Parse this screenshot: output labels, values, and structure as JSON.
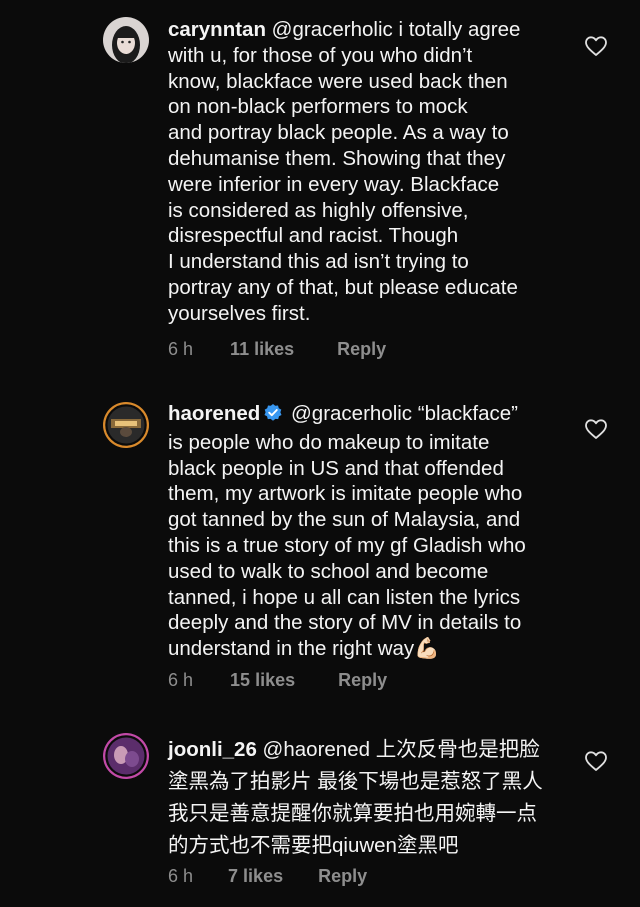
{
  "comments": [
    {
      "username": "carynntan",
      "verified": false,
      "text": " @gracerholic i totally agree\nwith u, for those of you who didn’t\nknow, blackface were used back then\non non-black performers to mock\nand portray black people. As a way to\ndehumanise them. Showing that they\nwere inferior in every way. Blackface\nis considered as highly offensive,\ndisrespectful and racist. Though\nI understand this ad isn’t trying to\nportray any of that, but please educate\nyourselves first.",
      "time": "6 h",
      "likes": "11 likes",
      "reply": "Reply",
      "icon": "heart-outline-icon"
    },
    {
      "username": "haorened",
      "verified": true,
      "text": " @gracerholic “blackface”\nis people who do makeup to imitate\nblack people in US and that offended\nthem, my artwork is imitate people who\ngot tanned by the sun of Malaysia, and\nthis is a true story of my gf Gladish who\nused to walk to school and become\ntanned, i hope u all can listen the lyrics\ndeeply and the story of MV in details to\nunderstand in the right way💪🏻",
      "time": "6 h",
      "likes": "15 likes",
      "reply": "Reply",
      "icon": "heart-outline-icon"
    },
    {
      "username": "joonli_26",
      "verified": false,
      "text": " @haorened 上次反骨也是把脸\n塗黑為了拍影片 最後下場也是惹怒了黑人\n我只是善意提醒你就算要拍也用婉轉一点\n的方式也不需要把qiuwen塗黑吧",
      "time": "6 h",
      "likes": "7 likes",
      "reply": "Reply",
      "icon": "heart-outline-icon"
    }
  ],
  "colors": {
    "background": "#0b0b0b",
    "text": "#f4f4f4",
    "meta": "#8e8e8e",
    "verified": "#3897f0"
  }
}
